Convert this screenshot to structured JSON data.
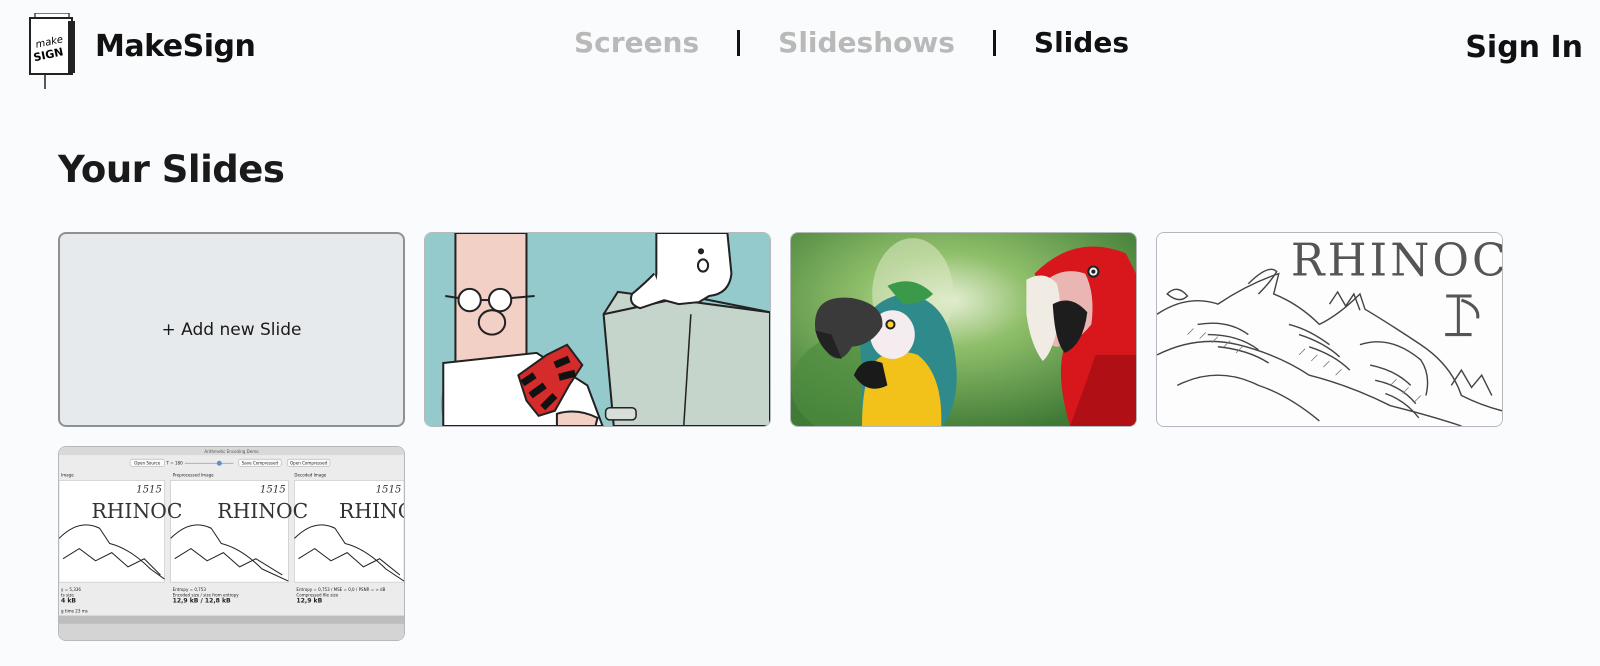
{
  "brand": {
    "name": "MakeSign",
    "logo_text": [
      "make",
      "SIGN"
    ]
  },
  "nav": {
    "items": [
      {
        "label": "Screens",
        "active": false
      },
      {
        "label": "Slideshows",
        "active": false
      },
      {
        "label": "Slides",
        "active": true
      }
    ]
  },
  "header": {
    "signin_label": "Sign In"
  },
  "page": {
    "title": "Your Slides"
  },
  "slides": {
    "add_label": "+ Add new Slide",
    "items": [
      {
        "kind": "cartoon-office"
      },
      {
        "kind": "parrots-photo"
      },
      {
        "kind": "engraving",
        "caption": "RHINOC"
      },
      {
        "kind": "app-screenshot",
        "window_title": "Arithmetic Encoding Demo",
        "buttons": [
          "Open Source",
          "T = 180",
          "Save Compressed",
          "Open Compressed"
        ],
        "panel_titles": [
          "Image",
          "Preprocessed Image",
          "Decoded Image"
        ],
        "engraving_word": "RHINOC",
        "year": "1515",
        "panel_stats": [
          [
            "y = 5,336",
            "ts size",
            "4 kB"
          ],
          [
            "Entropy = 0,753",
            "Encoded size / size from entropy",
            "12,9 kB  /  12,8 kB"
          ],
          [
            "Entropy = 0,753 / MSE = 0,0 / PSNR = ∞ dB",
            "Compressed file size",
            "12,9 kB"
          ]
        ],
        "footer_note": "g time 23 ms"
      }
    ]
  },
  "colors": {
    "page_bg": "#fafbfc",
    "nav_inactive": "#b9b9b9",
    "text": "#111111",
    "add_card_bg": "#e7eaed"
  }
}
